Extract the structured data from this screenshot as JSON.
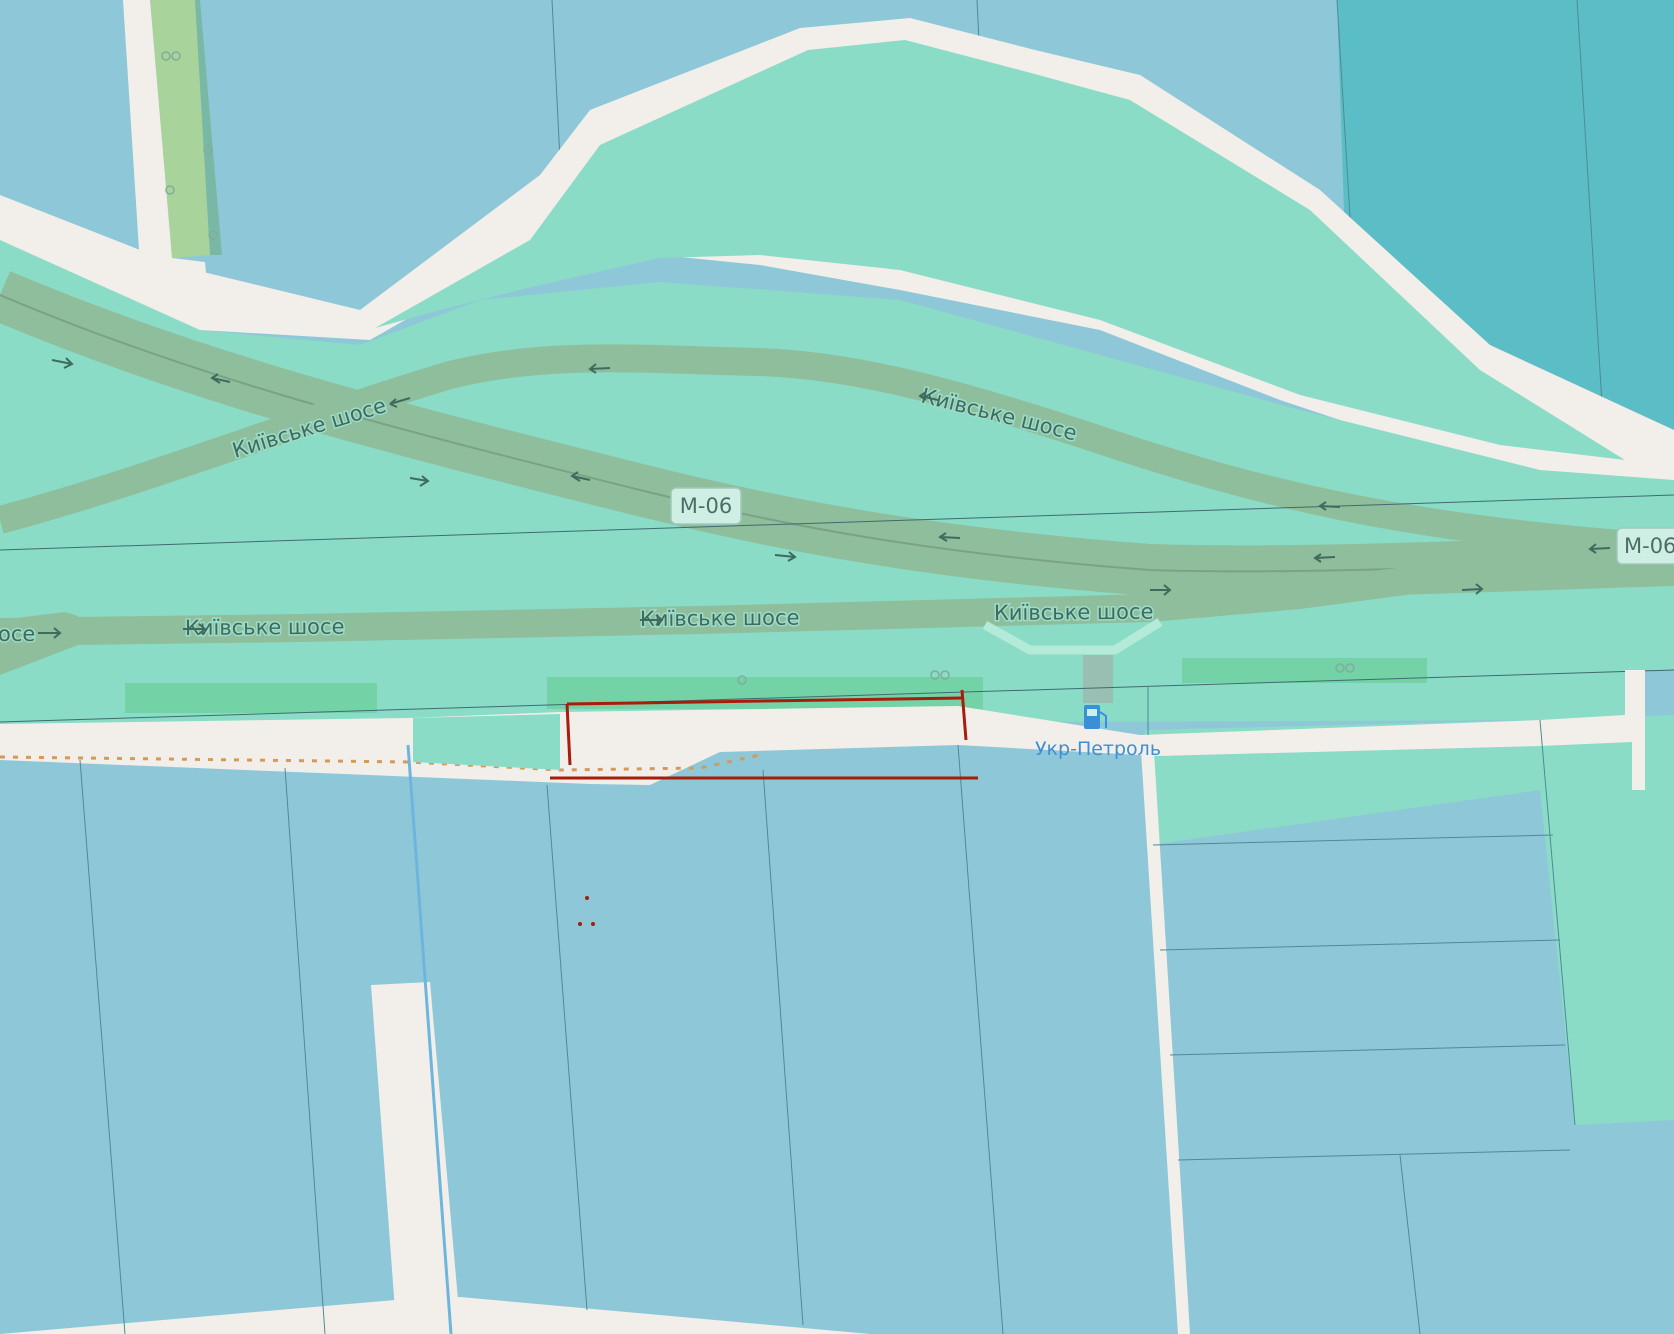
{
  "map": {
    "labels": {
      "road_main": "Київське шосе",
      "road_clipped": "осе",
      "highway_ref": "M-06",
      "highway_ref_clipped": "M-06"
    },
    "poi": {
      "name": "Укр-Петроль",
      "icon": "fuel-station-icon"
    },
    "colors": {
      "background_farmland": "#8ec8d8",
      "landuse_green": "#8adcc6",
      "landuse_dark": "#5bbdc6",
      "road_fill": "#8fbe9c",
      "road_casing": "#f2efea",
      "path_dotted": "#d49a5a",
      "marker_red": "#a81c0c",
      "poi_blue": "#3b8fd8",
      "tree_strip": "#a8d49c"
    }
  }
}
